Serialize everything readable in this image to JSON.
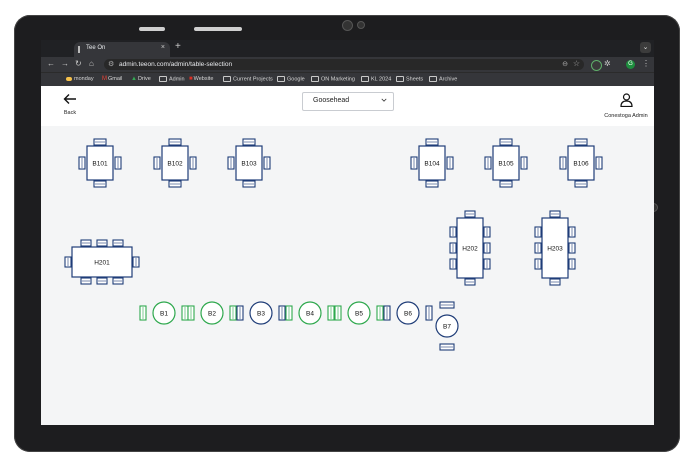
{
  "browser": {
    "tab_title": "Tee On",
    "tab_close": "×",
    "new_tab": "+",
    "url": "admin.teeon.com/admin/table-selection",
    "profile_initial": "G",
    "bookmarks": [
      "monday",
      "Gmail",
      "Drive",
      "Admin",
      "Website",
      "Current Projects",
      "Google",
      "ON Marketing",
      "KL 2024",
      "Sheets",
      "Archive"
    ]
  },
  "header": {
    "back_label": "Back",
    "course_select_value": "Goosehead",
    "user_label": "Conestoga Admin"
  },
  "tables": {
    "square": [
      "B101",
      "B102",
      "B103",
      "B104",
      "B105",
      "B106"
    ],
    "long_horizontal": [
      "H201"
    ],
    "long_vertical": [
      "H202",
      "H203"
    ],
    "round": [
      "B1",
      "B2",
      "B3",
      "B4",
      "B5",
      "B6",
      "B7"
    ]
  },
  "colors": {
    "table_blue": "#1f3d78",
    "table_green": "#2ea84d",
    "table_fill": "#ffffff"
  },
  "round_table_status": [
    "green",
    "green",
    "blue",
    "green",
    "green",
    "blue",
    "blue"
  ]
}
